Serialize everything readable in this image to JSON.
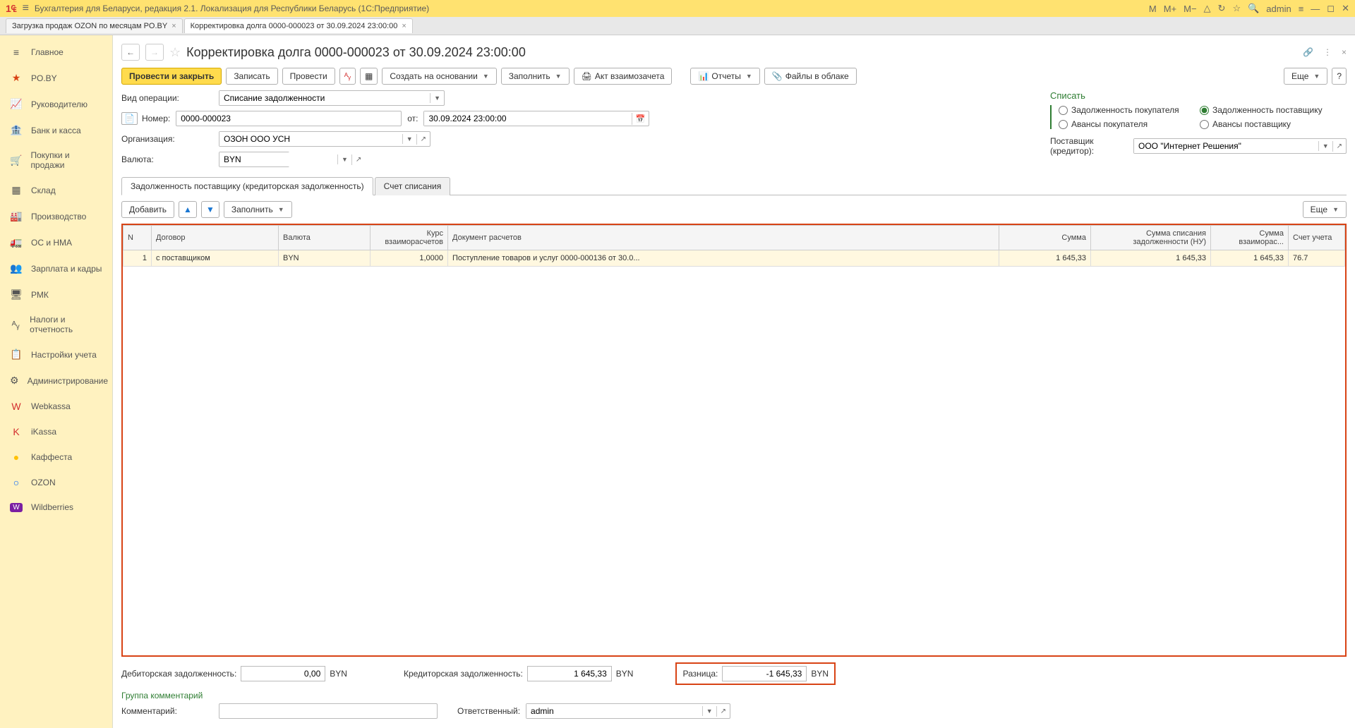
{
  "titlebar": {
    "title": "Бухгалтерия для Беларуси, редакция 2.1. Локализация для Республики Беларусь   (1С:Предприятие)",
    "user": "admin",
    "m": "M",
    "mplus": "M+",
    "mminus": "M−"
  },
  "tabs": [
    {
      "label": "Загрузка продаж OZON по месяцам PO.BY"
    },
    {
      "label": "Корректировка долга 0000-000023 от 30.09.2024 23:00:00"
    }
  ],
  "sidebar": [
    {
      "icon": "≡",
      "label": "Главное"
    },
    {
      "icon": "★",
      "label": "PO.BY"
    },
    {
      "icon": "📈",
      "label": "Руководителю"
    },
    {
      "icon": "🏦",
      "label": "Банк и касса"
    },
    {
      "icon": "🛒",
      "label": "Покупки и продажи"
    },
    {
      "icon": "▦",
      "label": "Склад"
    },
    {
      "icon": "🏭",
      "label": "Производство"
    },
    {
      "icon": "🚛",
      "label": "ОС и НМА"
    },
    {
      "icon": "👥",
      "label": "Зарплата и кадры"
    },
    {
      "icon": "🖥",
      "label": "РМК"
    },
    {
      "icon": "ᴬᵧ",
      "label": "Налоги и отчетность"
    },
    {
      "icon": "📋",
      "label": "Настройки учета"
    },
    {
      "icon": "⚙",
      "label": "Администрирование"
    },
    {
      "icon": "W",
      "label": "Webkassa"
    },
    {
      "icon": "K",
      "label": "iKassa"
    },
    {
      "icon": "●",
      "label": "Каффеста"
    },
    {
      "icon": "○",
      "label": "OZON"
    },
    {
      "icon": "W",
      "label": "Wildberries"
    }
  ],
  "doc": {
    "title": "Корректировка долга 0000-000023 от 30.09.2024 23:00:00",
    "buttons": {
      "post_close": "Провести и закрыть",
      "save": "Записать",
      "post": "Провести",
      "create_based": "Создать на основании",
      "fill": "Заполнить",
      "offset": "Акт взаимозачета",
      "reports": "Отчеты",
      "files": "Файлы в облаке",
      "more": "Еще"
    }
  },
  "form": {
    "op_type_label": "Вид операции:",
    "op_type": "Списание задолженности",
    "number_label": "Номер:",
    "number": "0000-000023",
    "date_label": "от:",
    "date": "30.09.2024 23:00:00",
    "org_label": "Организация:",
    "org": "ОЗОН ООО УСН",
    "currency_label": "Валюта:",
    "currency": "BYN",
    "writeoff_label": "Списать",
    "radios": {
      "r1": "Задолженность покупателя",
      "r2": "Задолженность поставщику",
      "r3": "Авансы покупателя",
      "r4": "Авансы поставщику"
    },
    "supplier_label": "Поставщик (кредитор):",
    "supplier": "ООО \"Интернет Решения\""
  },
  "subtabs": {
    "t1": "Задолженность поставщику (кредиторская задолженность)",
    "t2": "Счет списания"
  },
  "table_toolbar": {
    "add": "Добавить",
    "fill": "Заполнить",
    "more": "Еще"
  },
  "table": {
    "headers": [
      "N",
      "Договор",
      "Валюта",
      "Курс взаиморасчетов",
      "Документ расчетов",
      "Сумма",
      "Сумма списания задолженности (НУ)",
      "Сумма взаиморас...",
      "Счет учета"
    ],
    "row": {
      "n": "1",
      "contract": "с поставщиком",
      "currency": "BYN",
      "rate": "1,0000",
      "doc": "Поступление товаров и услуг 0000-000136 от 30.0...",
      "sum": "1 645,33",
      "sum_nu": "1 645,33",
      "sum_vz": "1 645,33",
      "account": "76.7"
    }
  },
  "bottom": {
    "debitor_label": "Дебиторская задолженность:",
    "debitor": "0,00",
    "debitor_cur": "BYN",
    "creditor_label": "Кредиторская задолженность:",
    "creditor": "1 645,33",
    "creditor_cur": "BYN",
    "diff_label": "Разница:",
    "diff": "-1 645,33",
    "diff_cur": "BYN",
    "comment_group": "Группа комментарий",
    "comment_label": "Комментарий:",
    "responsible_label": "Ответственный:",
    "responsible": "admin"
  }
}
